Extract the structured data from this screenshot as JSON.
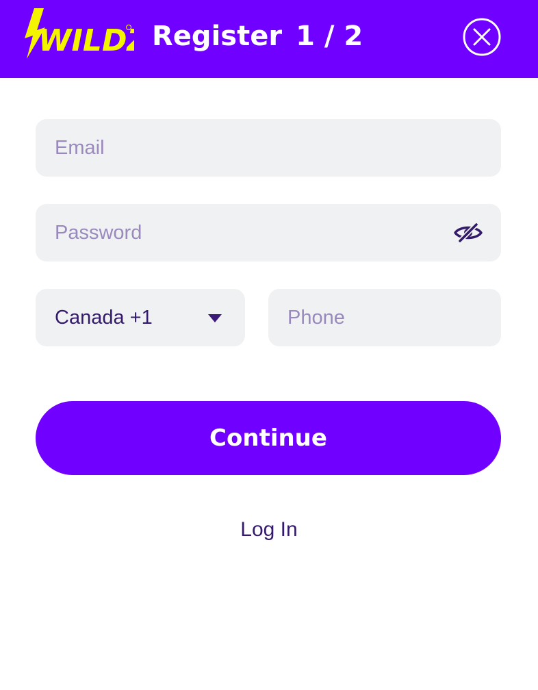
{
  "header": {
    "logo_text": "WILDZ",
    "title": "Register",
    "step": "1 / 2"
  },
  "form": {
    "email_placeholder": "Email",
    "password_placeholder": "Password",
    "country_value": "Canada +1",
    "phone_placeholder": "Phone",
    "continue_label": "Continue",
    "login_label": "Log In"
  },
  "icons": {
    "close": "close-icon",
    "password_toggle": "eye-off-icon",
    "dropdown": "caret-down-icon"
  },
  "colors": {
    "brand_purple": "#7000ff",
    "logo_yellow": "#f4f400",
    "field_bg": "#f0f1f2",
    "text_dark": "#341a6b",
    "placeholder": "#9a89bd"
  }
}
